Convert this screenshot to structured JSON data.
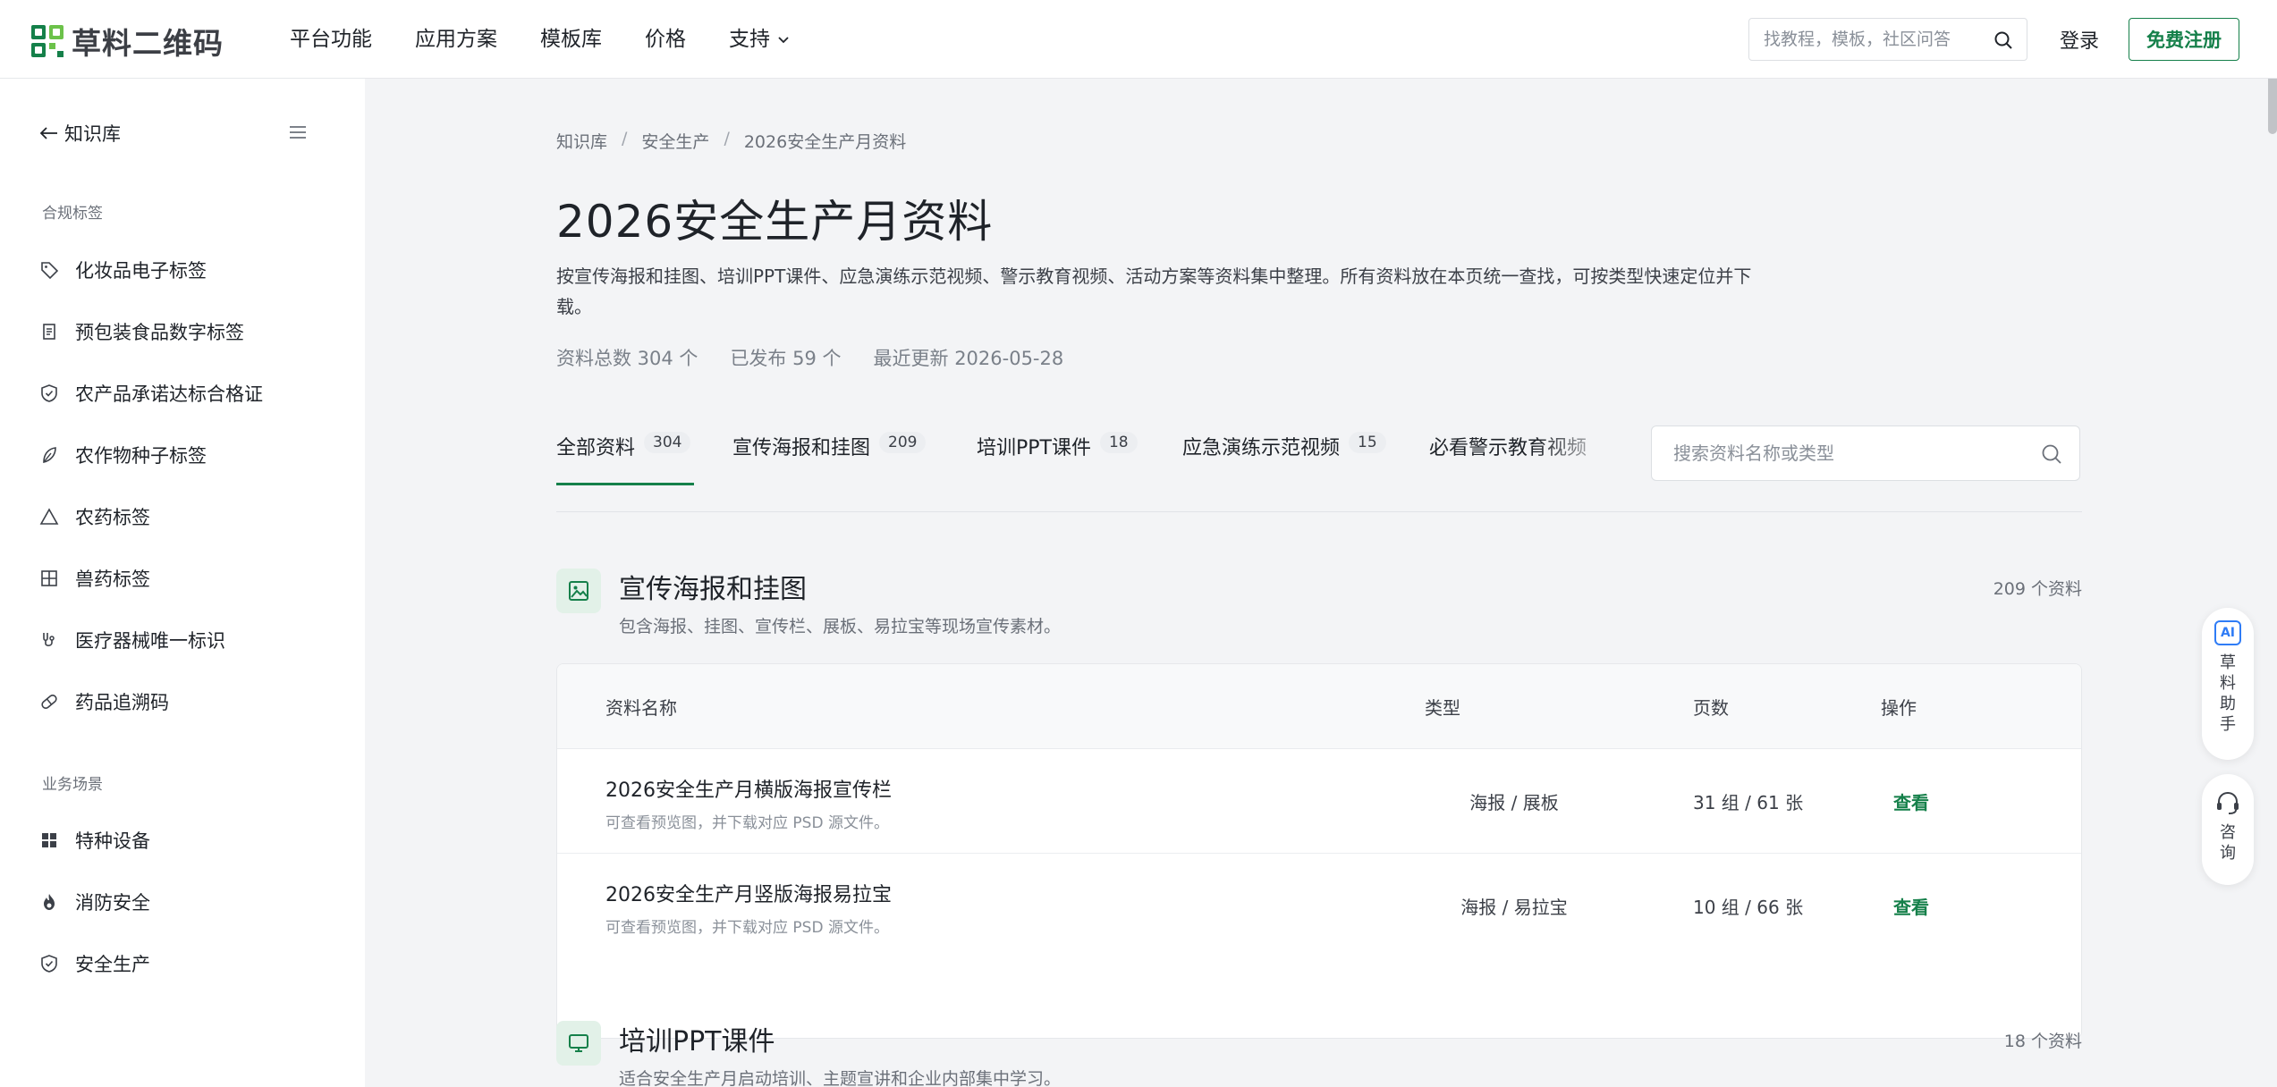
{
  "header": {
    "logo_text": "草料二维码",
    "nav": [
      {
        "label": "平台功能"
      },
      {
        "label": "应用方案"
      },
      {
        "label": "模板库"
      },
      {
        "label": "价格"
      },
      {
        "label": "支持"
      }
    ],
    "search_placeholder": "找教程，模板，社区问答",
    "login_label": "登录",
    "signup_label": "免费注册",
    "brand_color": "#15804a"
  },
  "sidebar": {
    "back_label": "知识库",
    "group1_label": "合规标签",
    "group1_items": [
      {
        "label": "化妆品电子标签",
        "icon": "tag-icon"
      },
      {
        "label": "预包装食品数字标签",
        "icon": "document-icon"
      },
      {
        "label": "农产品承诺达标合格证",
        "icon": "shield-check-icon"
      },
      {
        "label": "农作物种子标签",
        "icon": "leaf-icon"
      },
      {
        "label": "农药标签",
        "icon": "triangle-icon"
      },
      {
        "label": "兽药标签",
        "icon": "grid-icon"
      },
      {
        "label": "医疗器械唯一标识",
        "icon": "stethoscope-icon"
      },
      {
        "label": "药品追溯码",
        "icon": "pill-icon"
      }
    ],
    "group2_label": "业务场景",
    "group2_items": [
      {
        "label": "特种设备",
        "icon": "apps-icon"
      },
      {
        "label": "消防安全",
        "icon": "flame-icon"
      },
      {
        "label": "安全生产",
        "icon": "shield-check-icon"
      }
    ]
  },
  "main": {
    "breadcrumb": [
      "知识库",
      "安全生产",
      "2026安全生产月资料"
    ],
    "title": "2026安全生产月资料",
    "description": "按宣传海报和挂图、培训PPT课件、应急演练示范视频、警示教育视频、活动方案等资料集中整理。所有资料放在本页统一查找，可按类型快速定位并下载。",
    "stats": {
      "total": "资料总数 304 个",
      "published": "已发布 59 个",
      "updated": "最近更新 2026-05-28"
    },
    "tabs": [
      {
        "label": "全部资料",
        "count": "304"
      },
      {
        "label": "宣传海报和挂图",
        "count": "209"
      },
      {
        "label": "培训PPT课件",
        "count": "18"
      },
      {
        "label": "应急演练示范视频",
        "count": "15"
      },
      {
        "label": "必看警示教育视频",
        "count": ""
      }
    ],
    "tab_search_placeholder": "搜索资料名称或类型",
    "section1": {
      "title": "宣传海报和挂图",
      "subtitle": "包含海报、挂图、宣传栏、展板、易拉宝等现场宣传素材。",
      "count": "209 个资料",
      "icon": "image-icon"
    },
    "table": {
      "headers": [
        "资料名称",
        "类型",
        "页数",
        "操作"
      ],
      "rows": [
        {
          "name": "2026安全生产月横版海报宣传栏",
          "sub": "可查看预览图，并下载对应 PSD 源文件。",
          "type": "海报 / 展板",
          "pages": "31 组 / 61 张",
          "action": "查看"
        },
        {
          "name": "2026安全生产月竖版海报易拉宝",
          "sub": "可查看预览图，并下载对应 PSD 源文件。",
          "type": "海报 / 易拉宝",
          "pages": "10 组 / 66 张",
          "action": "查看"
        }
      ]
    },
    "section2": {
      "title": "培训PPT课件",
      "subtitle": "适合安全生产月启动培训、主题宣讲和企业内部集中学习。",
      "count": "18 个资料",
      "icon": "monitor-icon"
    }
  },
  "floating": {
    "assistant_badge": "AI",
    "assistant_label": "草料助手",
    "consult_label": "咨询"
  }
}
